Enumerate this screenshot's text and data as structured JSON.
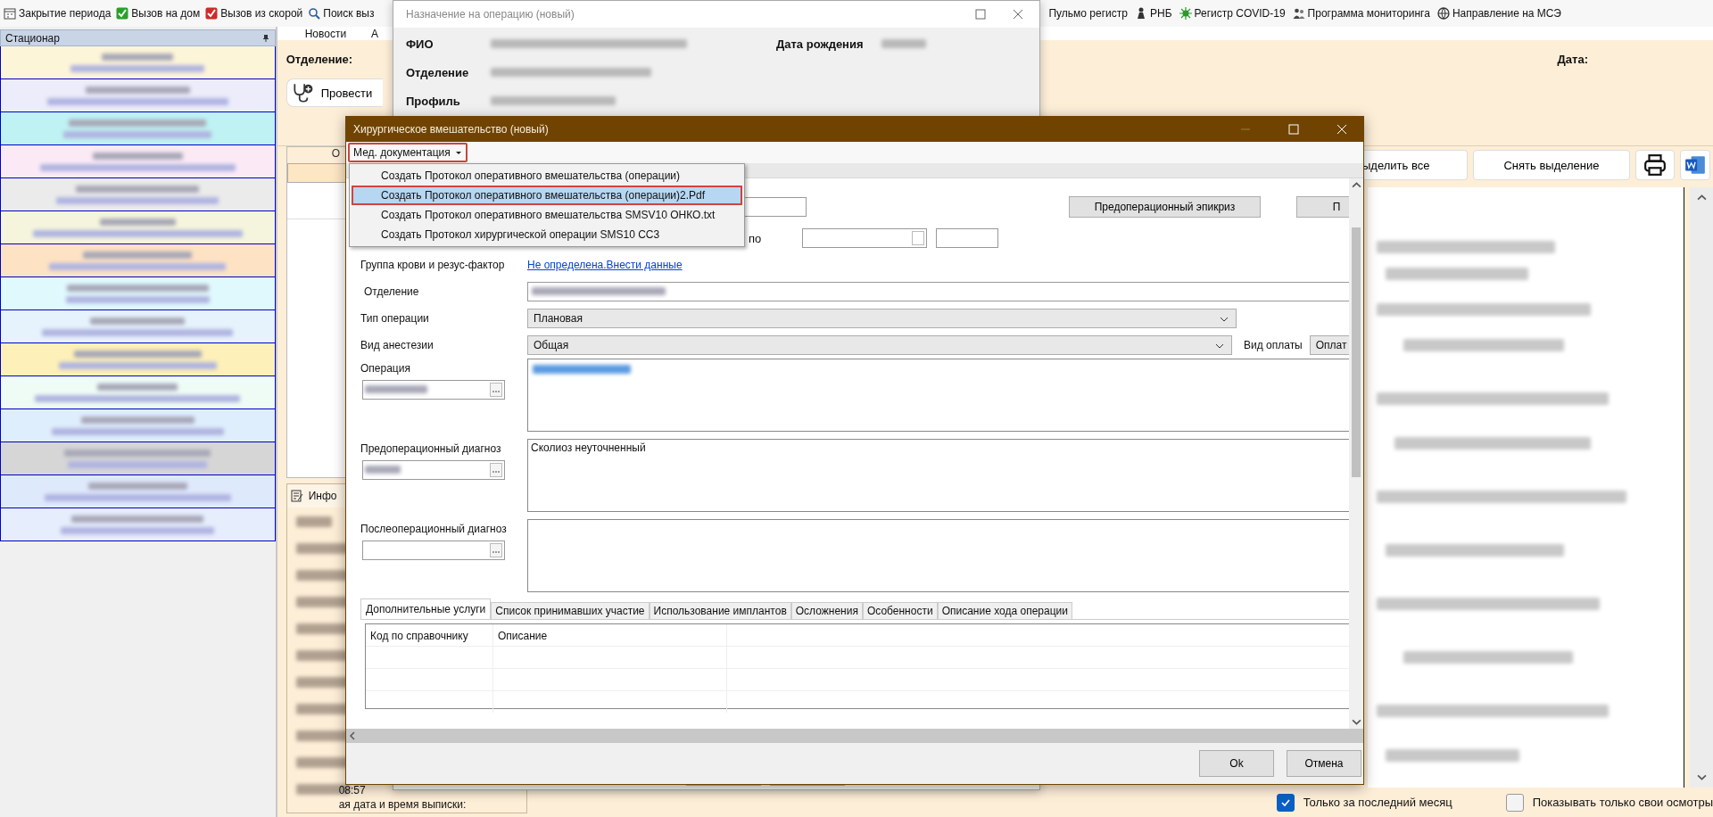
{
  "toolbar": {
    "left": [
      "Закрытие периода",
      "Вызов на дом",
      "Вызов из скорой",
      "Поиск выз"
    ],
    "right": [
      "Пульмо регистр",
      "РНБ",
      "Регистр COVID-19",
      "Программа мониторинга",
      "Направление на МСЭ"
    ]
  },
  "left_panel": {
    "title": "Стационар",
    "rows": [
      {
        "color": "#fdf5d8"
      },
      {
        "color": "#ececfa"
      },
      {
        "color": "#bff2f2"
      },
      {
        "color": "#fbeaf6"
      },
      {
        "color": "#ebebeb"
      },
      {
        "color": "#f5f5de"
      },
      {
        "color": "#fde2c4"
      },
      {
        "color": "#e0f9fd"
      },
      {
        "color": "#e6f3fc"
      },
      {
        "color": "#fdf0b8"
      },
      {
        "color": "#eefcf5"
      },
      {
        "color": "#dfeefc"
      },
      {
        "color": "#d6d6d6"
      },
      {
        "color": "#dfe9fc"
      },
      {
        "color": "#e6edfc"
      }
    ]
  },
  "main": {
    "tabs": [
      {
        "label": "Новости",
        "selected": false
      },
      {
        "label": "А",
        "selected": false
      }
    ],
    "department_label": "Отделение:",
    "date_label": "Дата:",
    "action_button": "Провести",
    "column_fragment": "О",
    "buttons": [
      "ыделить все",
      "Снять выделение"
    ],
    "info_panel": {
      "title": "Инфо",
      "time": "08:57",
      "text": "ая дата и время выписки:"
    },
    "filters": [
      {
        "label": "Только за последний месяц",
        "checked": true
      },
      {
        "label": "Показывать только свои осмотры",
        "checked": false
      }
    ]
  },
  "back_window": {
    "title": "Назначение на операцию (новый)",
    "fields": [
      "ФИО",
      "Отделение",
      "Профиль"
    ],
    "birth_label": "Дата рождения"
  },
  "dialog": {
    "title": "Хирургическое вмешательство (новый)",
    "menu": {
      "label": "Мед. документация",
      "annotated": true,
      "open": true,
      "items": [
        {
          "label": "Создать Протокол оперативного вмешательства (операции)",
          "selected": false
        },
        {
          "label": "Создать Протокол оперативного вмешательства (операции)2.Pdf",
          "selected": true
        },
        {
          "label": "Создать Протокол оперативного вмешательства SMSV10 ОНКО.txt",
          "selected": false
        },
        {
          "label": "Создать Протокол хирургической операции SMS10 СС3",
          "selected": false
        }
      ]
    },
    "epicrisis_button": "Предоперационный эпикриз",
    "cut_button": "П",
    "to_label": "по",
    "blood_label": "Группа крови и резус-фактор",
    "blood_link": "Не определена.Внести данные",
    "department_label": "Отделение",
    "operation_type_label": "Тип операции",
    "operation_type": "Плановая",
    "anesthesia_label": "Вид анестезии",
    "anesthesia": "Общая",
    "payment_label": "Вид оплаты",
    "payment": "Оплат",
    "operation_label": "Операция",
    "preop_label": "Предоперационный диагноз",
    "preop_text": "Сколиоз неуточненный",
    "postop_label": "Послеоперационный диагноз",
    "tabs": [
      {
        "label": "Дополнительные услуги",
        "selected": true
      },
      {
        "label": "Список принимавших участие",
        "selected": false
      },
      {
        "label": "Использование имплантов",
        "selected": false
      },
      {
        "label": "Осложнения",
        "selected": false
      },
      {
        "label": "Особенности",
        "selected": false
      },
      {
        "label": "Описание хода операции",
        "selected": false
      }
    ],
    "table": {
      "columns": [
        "Код по справочнику",
        "Описание"
      ]
    },
    "buttons": [
      "Ok",
      "Отмена"
    ]
  }
}
